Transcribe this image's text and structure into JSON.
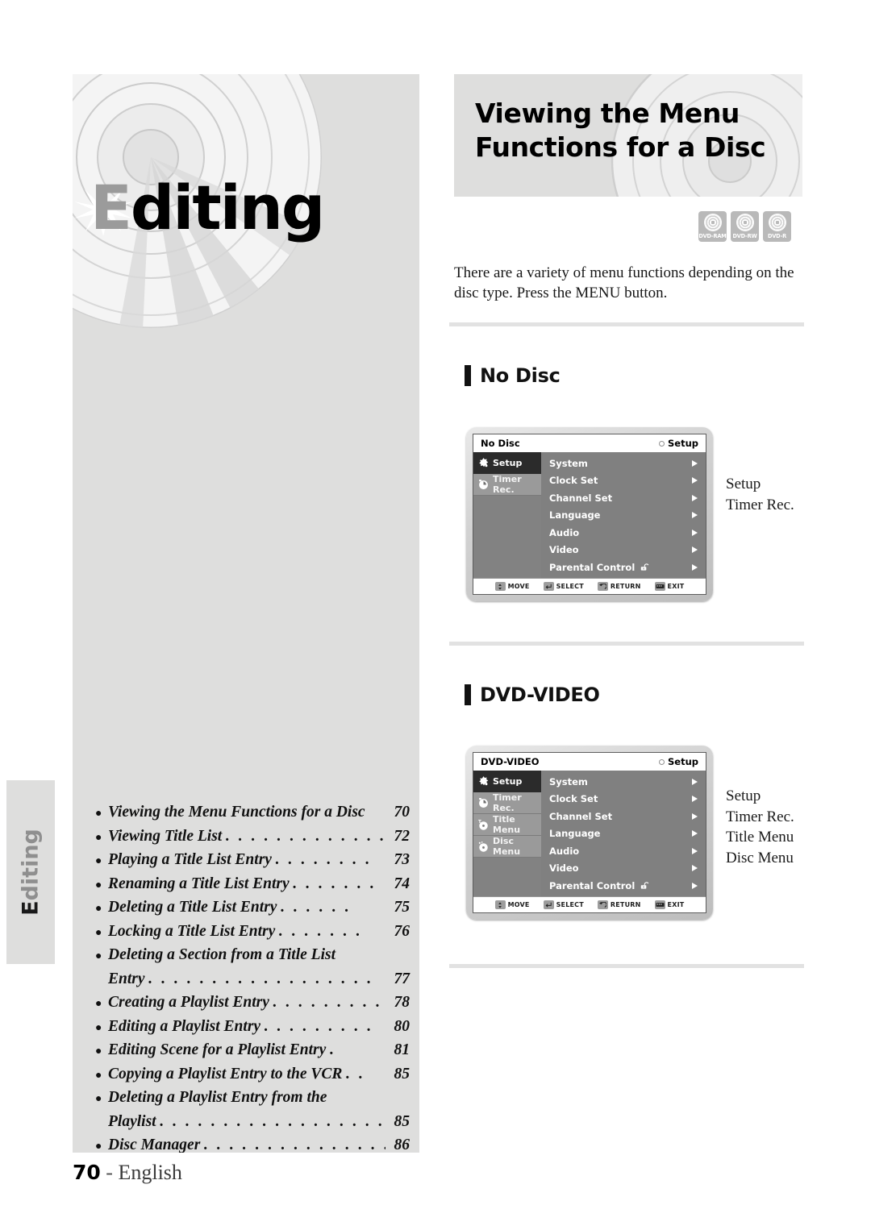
{
  "chapter": {
    "title_first": "E",
    "title_rest": "diting",
    "side_tab_first": "E",
    "side_tab_rest": "diting"
  },
  "header": {
    "line1": "Viewing the Menu",
    "line2": "Functions for a Disc"
  },
  "disc_badges": [
    {
      "label": "DVD-RAM",
      "icon": "disc-icon"
    },
    {
      "label": "DVD-RW",
      "icon": "disc-icon"
    },
    {
      "label": "DVD-R",
      "icon": "disc-icon"
    }
  ],
  "intro": "There are a variety of menu functions depending on the disc type. Press the MENU button.",
  "sections": [
    {
      "heading": "No Disc"
    },
    {
      "heading": "DVD-VIDEO"
    }
  ],
  "osd_no_disc": {
    "title": "No Disc",
    "title_right": "Setup",
    "sidebar": [
      {
        "label": "Setup",
        "icon": "gear-icon",
        "selected": true
      },
      {
        "label": "Timer Rec.",
        "icon": "timer-icon",
        "selected": false
      }
    ],
    "menu": [
      {
        "label": "System",
        "arrow": true
      },
      {
        "label": "Clock Set",
        "arrow": true
      },
      {
        "label": "Channel Set",
        "arrow": true
      },
      {
        "label": "Language",
        "arrow": true
      },
      {
        "label": "Audio",
        "arrow": true
      },
      {
        "label": "Video",
        "arrow": true
      },
      {
        "label": "Parental Control",
        "arrow": true,
        "icon": "unlocked-padlock-icon"
      }
    ],
    "footer": [
      {
        "label": "MOVE",
        "icon": "updown-arrows-icon"
      },
      {
        "label": "SELECT",
        "icon": "enter-key-icon"
      },
      {
        "label": "RETURN",
        "icon": "return-arrow-icon"
      },
      {
        "label": "EXIT",
        "icon": "exit-key-icon"
      }
    ],
    "callout": [
      "Setup",
      "Timer Rec."
    ]
  },
  "osd_dvd_video": {
    "title": "DVD-VIDEO",
    "title_right": "Setup",
    "sidebar": [
      {
        "label": "Setup",
        "icon": "gear-icon",
        "selected": true
      },
      {
        "label": "Timer Rec.",
        "icon": "timer-icon",
        "selected": false
      },
      {
        "label": "Title Menu",
        "icon": "title-menu-icon",
        "selected": false
      },
      {
        "label": "Disc Menu",
        "icon": "disc-menu-icon",
        "selected": false
      }
    ],
    "menu": [
      {
        "label": "System",
        "arrow": true
      },
      {
        "label": "Clock Set",
        "arrow": true
      },
      {
        "label": "Channel Set",
        "arrow": true
      },
      {
        "label": "Language",
        "arrow": true
      },
      {
        "label": "Audio",
        "arrow": true
      },
      {
        "label": "Video",
        "arrow": true
      },
      {
        "label": "Parental Control",
        "arrow": true,
        "icon": "unlocked-padlock-icon"
      }
    ],
    "footer": [
      {
        "label": "MOVE",
        "icon": "updown-arrows-icon"
      },
      {
        "label": "SELECT",
        "icon": "enter-key-icon"
      },
      {
        "label": "RETURN",
        "icon": "return-arrow-icon"
      },
      {
        "label": "EXIT",
        "icon": "exit-key-icon"
      }
    ],
    "callout": [
      "Setup",
      "Timer Rec.",
      "Title Menu",
      "Disc Menu"
    ]
  },
  "toc": [
    {
      "label": "Viewing the Menu Functions for a Disc",
      "page": "70",
      "dots": "",
      "cont": false
    },
    {
      "label": "Viewing Title List",
      "page": "72",
      "dots": ". . . . . . . . . . . . .",
      "cont": false
    },
    {
      "label": "Playing a Title List Entry",
      "page": "73",
      "dots": ". . . . . . . .",
      "cont": false
    },
    {
      "label": "Renaming a Title List Entry",
      "page": "74",
      "dots": ". . . . . . .",
      "cont": false
    },
    {
      "label": "Deleting a Title List Entry",
      "page": "75",
      "dots": ". . . . . .",
      "cont": false
    },
    {
      "label": "Locking a Title List Entry",
      "page": "76",
      "dots": ". . . . . . .",
      "cont": false
    },
    {
      "label": "Deleting a Section from a Title List",
      "page": "",
      "dots": "",
      "cont": false
    },
    {
      "label": "Entry",
      "page": "77",
      "dots": ". . . . . . . . . . . . . . . . . .",
      "cont": true
    },
    {
      "label": "Creating a Playlist Entry",
      "page": "78",
      "dots": ". . . . . . . . . . . .",
      "cont": false
    },
    {
      "label": "Editing a Playlist Entry",
      "page": "80",
      "dots": ". . . . . . . . .",
      "cont": false
    },
    {
      "label": "Editing Scene for a Playlist Entry",
      "page": "81",
      "dots": ".",
      "cont": false
    },
    {
      "label": "Copying a Playlist Entry to the VCR",
      "page": "85",
      "dots": ". .",
      "cont": false
    },
    {
      "label": "Deleting a Playlist Entry from the",
      "page": "",
      "dots": "",
      "cont": false
    },
    {
      "label": "Playlist",
      "page": "85",
      "dots": ". . . . . . . . . . . . . . . . . . .",
      "cont": true
    },
    {
      "label": "Disc Manager",
      "page": "86",
      "dots": ". . . . . . . . . . . . . . .",
      "cont": false
    }
  ],
  "footer": {
    "page_number": "70",
    "dash": "-",
    "language": "English"
  },
  "colors": {
    "panel_gray": "#dededd",
    "osd_gray": "#808080",
    "osd_selected": "#2b2b2b",
    "badge_gray": "#b9b9b9",
    "rule": "#e2e2e2"
  }
}
